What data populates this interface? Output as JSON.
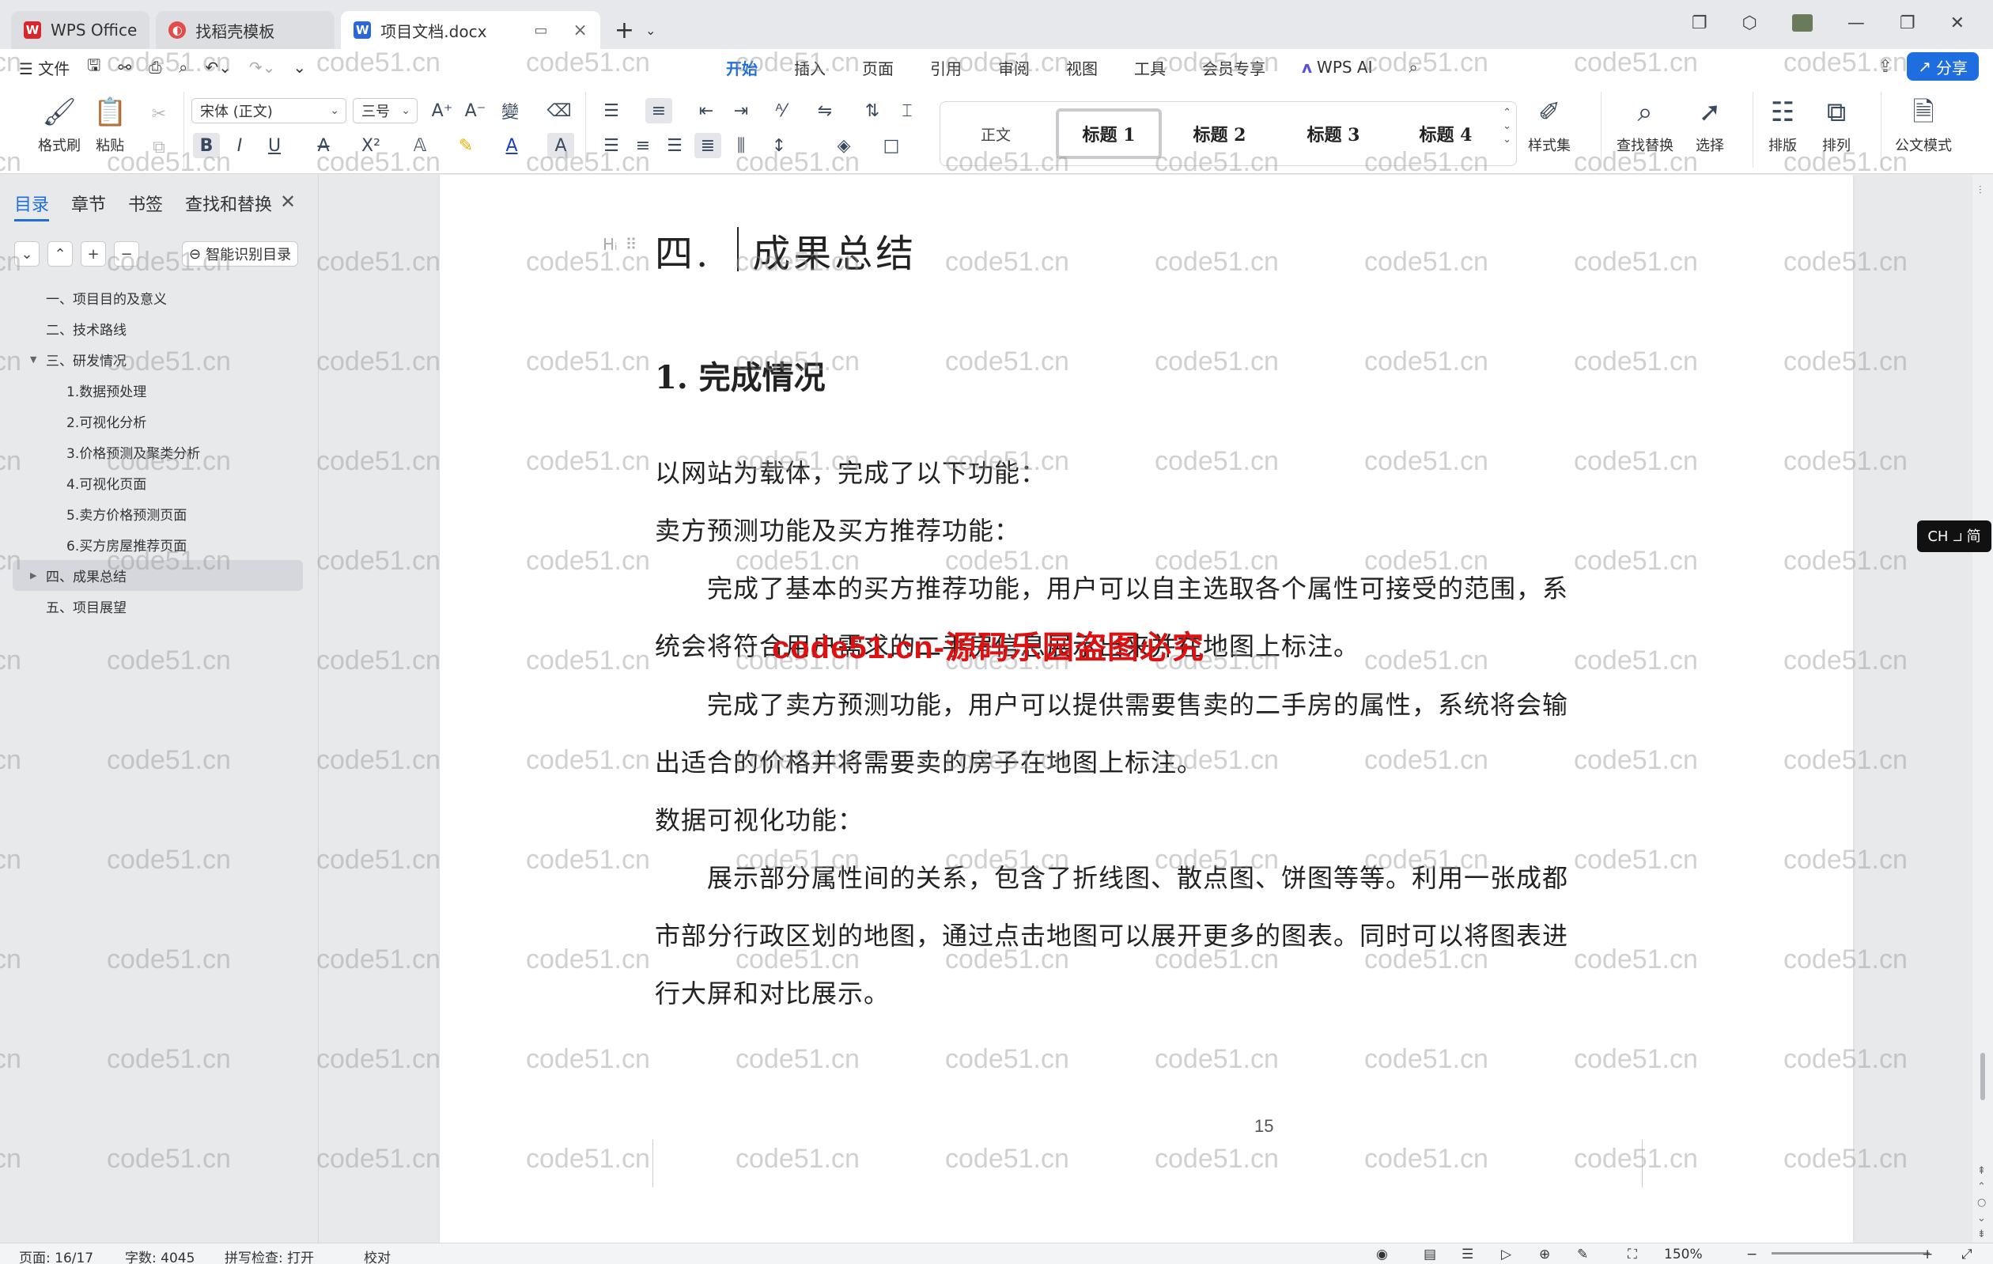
{
  "tabs": [
    {
      "label": "WPS Office",
      "logo": "W",
      "color": "#d9262c"
    },
    {
      "label": "找稻壳模板",
      "logo": "◐",
      "color": "#e34a4a"
    },
    {
      "label": "项目文档.docx",
      "logo": "W",
      "color": "#2b67d8"
    }
  ],
  "menu": {
    "file": "文件",
    "tabs": [
      "开始",
      "插入",
      "页面",
      "引用",
      "审阅",
      "视图",
      "工具",
      "会员专享"
    ],
    "ai": "WPS AI",
    "share": "分享"
  },
  "ribbon": {
    "format_painter": "格式刷",
    "paste": "粘贴",
    "font_name": "宋体 (正文)",
    "font_size": "三号",
    "styles": [
      "正文",
      "标题 1",
      "标题 2",
      "标题 3",
      "标题 4"
    ],
    "style_set": "样式集",
    "find_replace": "查找替换",
    "select": "选择",
    "layout": "排版",
    "arrange": "排列",
    "official_mode": "公文模式"
  },
  "nav": {
    "tabs": [
      "目录",
      "章节",
      "书签",
      "查找和替换"
    ],
    "smart_btn": "智能识别目录",
    "toc": [
      {
        "label": "一、项目目的及意义",
        "level": 1
      },
      {
        "label": "二、技术路线",
        "level": 1
      },
      {
        "label": "三、研发情况",
        "level": 1,
        "expanded": true
      },
      {
        "label": "1.数据预处理",
        "level": 2
      },
      {
        "label": "2.可视化分析",
        "level": 2
      },
      {
        "label": "3.价格预测及聚类分析",
        "level": 2
      },
      {
        "label": "4.可视化页面",
        "level": 2
      },
      {
        "label": "5.卖方价格预测页面",
        "level": 2
      },
      {
        "label": "6.买方房屋推荐页面",
        "level": 2
      },
      {
        "label": "四、成果总结",
        "level": 1,
        "active": true
      },
      {
        "label": "五、项目展望",
        "level": 1
      }
    ]
  },
  "document": {
    "heading1": "四.　成果总结",
    "heading2": "1. 完成情况",
    "lines": [
      "以网站为载体，完成了以下功能：",
      "卖方预测功能及买方推荐功能：",
      "　　完成了基本的买方推荐功能，用户可以自主选取各个属性可接受的范围，系",
      "统会将符合用户需求的二手房信息展示出来并在地图上标注。",
      "　　完成了卖方预测功能，用户可以提供需要售卖的二手房的属性，系统将会输",
      "出适合的价格并将需要卖的房子在地图上标注。",
      "数据可视化功能：",
      "　　展示部分属性间的关系，包含了折线图、散点图、饼图等等。利用一张成都",
      "市部分行政区划的地图，通过点击地图可以展开更多的图表。同时可以将图表进",
      "行大屏和对比展示。"
    ],
    "page_number": "15",
    "red_watermark": "code51.cn-源码乐园盗图必究"
  },
  "ime_badge": "CH ⯾ 简",
  "status": {
    "page": "页面: 16/17",
    "words": "字数: 4045",
    "spell": "拼写检查: 打开",
    "proof": "校对",
    "zoom": "150%"
  },
  "watermark_text": "code51.cn"
}
